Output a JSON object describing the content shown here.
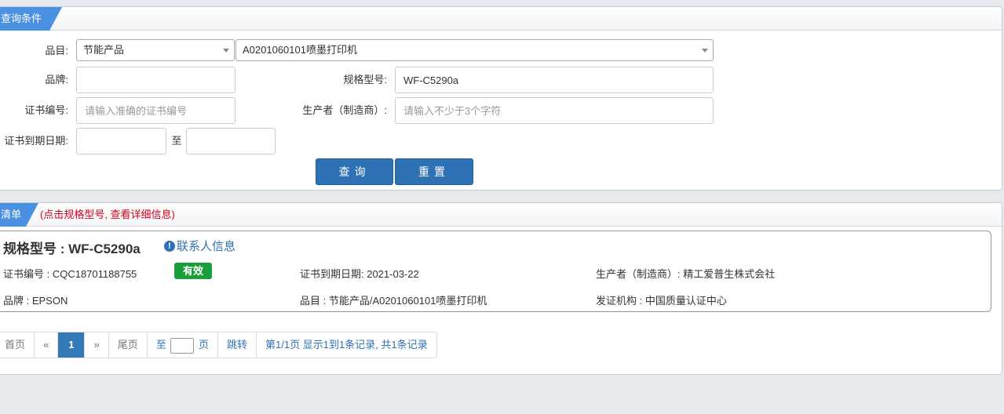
{
  "query_panel": {
    "tab_label": "查询条件",
    "category_label": "品目:",
    "category_value": "节能产品",
    "subcategory_value": "A0201060101喷墨打印机",
    "brand_label": "品牌:",
    "brand_value": "",
    "model_label": "规格型号:",
    "model_value": "WF-C5290a",
    "cert_no_label": "证书编号:",
    "cert_no_placeholder": "请输入准确的证书编号",
    "producer_label": "生产者（制造商）:",
    "producer_placeholder": "请输入不少于3个字符",
    "expiry_label": "证书到期日期:",
    "to_label": "至",
    "search_button": "查询",
    "reset_button": "重置"
  },
  "list_panel": {
    "tab_label": "清单",
    "hint": "(点击规格型号, 查看详细信息)"
  },
  "result": {
    "title": "规格型号 : WF-C5290a",
    "contact_link": "联系人信息",
    "cert_no": "证书编号 : CQC18701188755",
    "status": "有效",
    "expiry": "证书到期日期: 2021-03-22",
    "producer": "生产者（制造商）: 精工爱普生株式会社",
    "brand": "品牌 : EPSON",
    "category": "品目 : 节能产品/A0201060101喷墨打印机",
    "issuer": "发证机构 : 中国质量认证中心"
  },
  "pagination": {
    "first": "首页",
    "prev": "«",
    "current": "1",
    "next": "»",
    "last": "尾页",
    "goto_prefix": "至",
    "goto_suffix": "页",
    "jump": "跳转",
    "summary": "第1/1页  显示1到1条记录, 共1条记录"
  },
  "colors": {
    "accent": "#2f71b5",
    "tab": "#4a90e2",
    "hint_red": "#d9001b",
    "status_green": "#1a9e3b"
  }
}
